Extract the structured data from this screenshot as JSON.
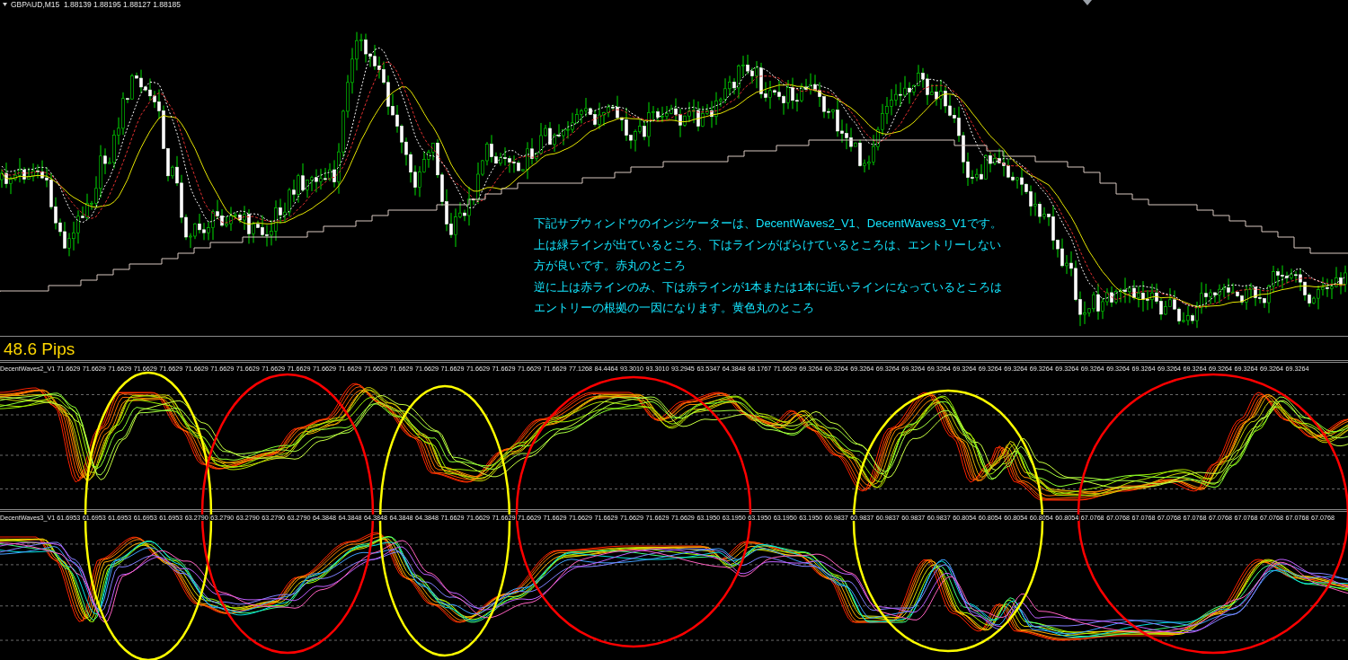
{
  "symbol_header": {
    "text": "GBPAUD,M15  1.88139 1.88195 1.88127 1.88185"
  },
  "annotation": {
    "lines": [
      "下記サブウィンドウのインジケーターは、DecentWaves2_V1、DecentWaves3_V1です。",
      "上は緑ラインが出ているところ、下はラインがばらけているところは、エントリーしない",
      "方が良いです。赤丸のところ",
      "逆に上は赤ラインのみ、下は赤ラインが1本または1本に近いラインになっているところは",
      "エントリーの根拠の一因になります。黄色丸のところ"
    ]
  },
  "pips_label": "48.6 Pips",
  "indicators": [
    {
      "name": "DecentWaves2_V1",
      "values": [
        "71.6629",
        "71.6629",
        "71.6629",
        "71.6629",
        "71.6629",
        "71.6629",
        "71.6629",
        "71.6629",
        "71.6629",
        "71.6629",
        "71.6629",
        "71.6629",
        "71.6629",
        "71.6629",
        "71.6629",
        "71.6629",
        "71.6629",
        "71.6629",
        "71.6629",
        "71.6629",
        "77.1268",
        "84.4464",
        "93.3010",
        "93.3010",
        "93.2945",
        "63.5347",
        "64.3848",
        "68.1767",
        "71.6629",
        "69.3264",
        "69.3264",
        "69.3264",
        "69.3264",
        "69.3264",
        "69.3264",
        "69.3264",
        "69.3264",
        "69.3264",
        "69.3264",
        "69.3264",
        "69.3264",
        "69.3264",
        "69.3264",
        "69.3264",
        "69.3264",
        "69.3264",
        "69.3264",
        "69.3264",
        "69.3264"
      ]
    },
    {
      "name": "DecentWaves3_V1",
      "values": [
        "61.6953",
        "61.6953",
        "61.6953",
        "61.6953",
        "61.6953",
        "63.2790",
        "63.2790",
        "63.2790",
        "63.2790",
        "63.2790",
        "64.3848",
        "64.3848",
        "64.3848",
        "64.3848",
        "64.3848",
        "71.6629",
        "71.6629",
        "71.6629",
        "71.6629",
        "71.6629",
        "71.6629",
        "71.6629",
        "71.6629",
        "71.6629",
        "71.6629",
        "63.1950",
        "63.1950",
        "63.1950",
        "63.1950",
        "63.1950",
        "60.9837",
        "60.9837",
        "60.9837",
        "60.9837",
        "60.9837",
        "60.8054",
        "60.8054",
        "60.8054",
        "60.8054",
        "60.8054",
        "67.0768",
        "67.0768",
        "67.0768",
        "67.0768",
        "67.0768",
        "67.0768",
        "67.0768",
        "67.0768",
        "67.0768",
        "67.0768"
      ]
    }
  ],
  "circles": [
    {
      "color": "#ffff00"
    },
    {
      "color": "#ff0000"
    },
    {
      "color": "#ffff00"
    },
    {
      "color": "#ff0000"
    },
    {
      "color": "#ffff00"
    },
    {
      "color": "#ff0000"
    }
  ]
}
